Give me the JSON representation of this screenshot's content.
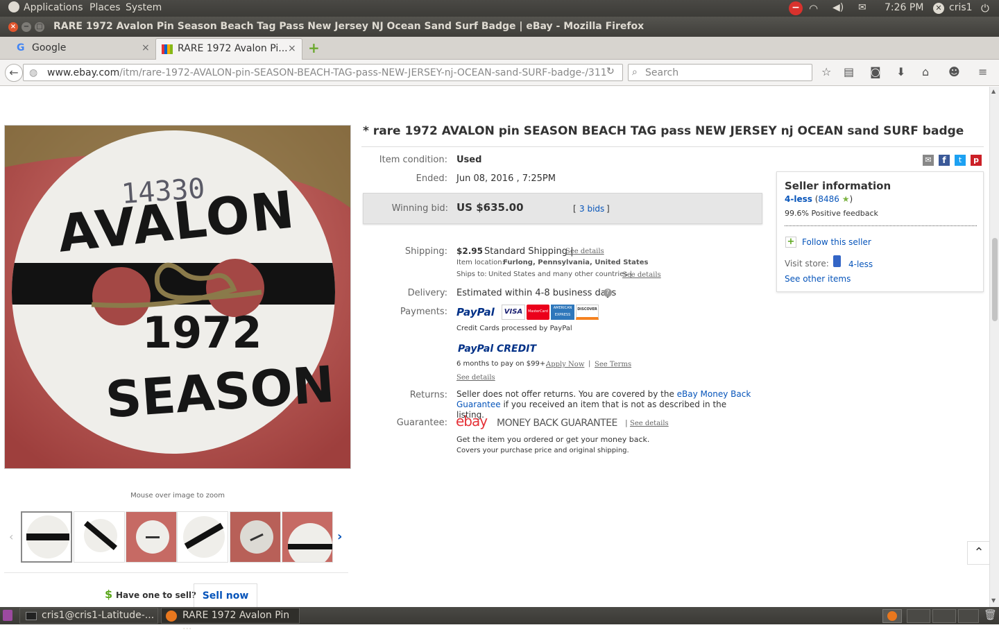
{
  "system_bar": {
    "applications": "Applications",
    "places": "Places",
    "system": "System",
    "clock": "7:26 PM",
    "user": "cris1"
  },
  "window": {
    "title": "RARE 1972 Avalon Pin Season Beach Tag Pass New Jersey NJ Ocean Sand Surf Badge | eBay - Mozilla Firefox"
  },
  "tabs": [
    {
      "label": "Google"
    },
    {
      "label": "RARE 1972 Avalon Pi..."
    }
  ],
  "navbar": {
    "url_host": "www.ebay.com",
    "url_path": "/itm/rare-1972-AVALON-pin-SEASON-BEACH-TAG-pass-NEW-JERSEY-nj-OCEAN-sand-SURF-badge-/311",
    "search_placeholder": "Search"
  },
  "listing": {
    "title": "* rare 1972 AVALON pin SEASON BEACH TAG pass NEW JERSEY nj OCEAN sand SURF badge",
    "condition_label": "Item condition:",
    "condition_value": "Used",
    "ended_label": "Ended:",
    "ended_value": "Jun 08, 2016 , 7:25PM",
    "winning_bid_label": "Winning bid:",
    "winning_bid_value": "US $635.00",
    "bids_open": "[",
    "bids_link": "3 bids",
    "bids_close": "]",
    "shipping_label": "Shipping:",
    "shipping_price": "$2.95",
    "shipping_method": "Standard Shipping |",
    "see_details": "See details",
    "item_location_label": "Item location:",
    "item_location_value": "Furlong, Pennsylvania, United States",
    "ships_to_label": "Ships to:",
    "ships_to_value": "United States and many other countries |",
    "delivery_label": "Delivery:",
    "delivery_value": "Estimated within 4-8 business days",
    "payments_label": "Payments:",
    "paypal": "PayPal",
    "credit_cards_note": "Credit Cards processed by PayPal",
    "paypal_credit": "PayPal CREDIT",
    "paypal_credit_terms": "6 months to pay on $99+.",
    "apply_now": "Apply Now",
    "see_terms": "See Terms",
    "returns_label": "Returns:",
    "returns_text": "Seller does not offer returns. You are covered by the",
    "returns_link": "eBay Money Back Guarantee",
    "returns_text2": "if you received an item that is not as described in the listing.",
    "guarantee_label": "Guarantee:",
    "guarantee_brand": "ebay",
    "guarantee_title": "MONEY BACK GUARANTEE",
    "guarantee_line1": "Get the item you ordered or get your money back.",
    "guarantee_line2": "Covers your purchase price and original shipping."
  },
  "card_logos": [
    "VISA",
    "MasterCard",
    "AMERICAN EXPRESS",
    "DISCOVER"
  ],
  "seller": {
    "heading": "Seller information",
    "name": "4-less",
    "feedback_open": "(",
    "feedback_count": "8486",
    "feedback_close": ")",
    "positive": "99.6% Positive feedback",
    "follow": "Follow this seller",
    "visit_store_label": "Visit store:",
    "store_name": "4-less",
    "see_other": "See other items"
  },
  "gallery": {
    "zoom_hint": "Mouse over image to zoom",
    "badge_number": "14330",
    "badge_top": "AVALON",
    "badge_year": "1972",
    "badge_bottom": "SEASON"
  },
  "sell_prompt": {
    "question": "Have one to sell?",
    "button": "Sell now"
  },
  "taskbar": {
    "terminal": "cris1@cris1-Latitude-...",
    "firefox": "RARE 1972 Avalon Pin ..."
  },
  "colors": {
    "ebay_red": "#e53238",
    "ebay_blue": "#0064d2",
    "ebay_yellow": "#f5af02",
    "ebay_green": "#86b817",
    "link": "#0654ba"
  }
}
